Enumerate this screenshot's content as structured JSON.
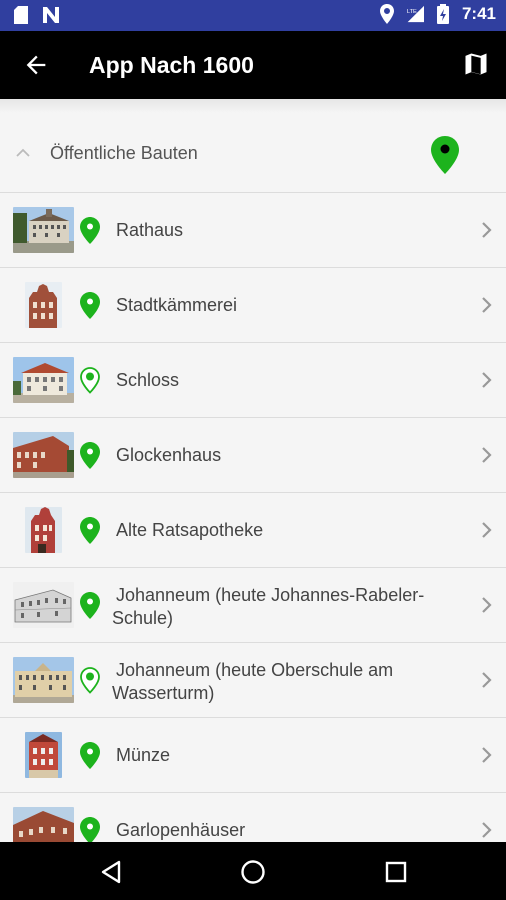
{
  "status_bar": {
    "time": "7:41",
    "left_icons": [
      "sd-card-icon",
      "n-notification-icon"
    ],
    "right_icons": [
      "location-icon",
      "lte-signal-icon",
      "battery-icon"
    ]
  },
  "app_bar": {
    "title": "App Nach 1600",
    "back_icon": "arrow-back-icon",
    "action_icon": "map-icon"
  },
  "group": {
    "title": "Öffentliche Bauten",
    "expanded": true
  },
  "colors": {
    "status_bar": "#303f9f",
    "app_bar": "#000000",
    "pin_green": "#1db31d",
    "text": "#444444"
  },
  "items": [
    {
      "label": "Rathaus",
      "thumb": "wide",
      "pin": "filled"
    },
    {
      "label": "Stadtkämmerei",
      "thumb": "narrow",
      "pin": "filled"
    },
    {
      "label": "Schloss",
      "thumb": "wide",
      "pin": "outline"
    },
    {
      "label": "Glockenhaus",
      "thumb": "wide",
      "pin": "filled"
    },
    {
      "label": "Alte Ratsapotheke",
      "thumb": "narrow",
      "pin": "filled"
    },
    {
      "label": "Johanneum (heute Johannes-Rabeler-Schule)",
      "thumb": "wide",
      "pin": "filled"
    },
    {
      "label": "Johanneum (heute Oberschule am Wasserturm)",
      "thumb": "wide",
      "pin": "outline"
    },
    {
      "label": "Münze",
      "thumb": "narrow",
      "pin": "filled"
    },
    {
      "label": "Garlopenhäuser",
      "thumb": "wide",
      "pin": "filled"
    }
  ],
  "nav_bar": [
    "back-triangle-icon",
    "home-circle-icon",
    "recents-square-icon"
  ]
}
